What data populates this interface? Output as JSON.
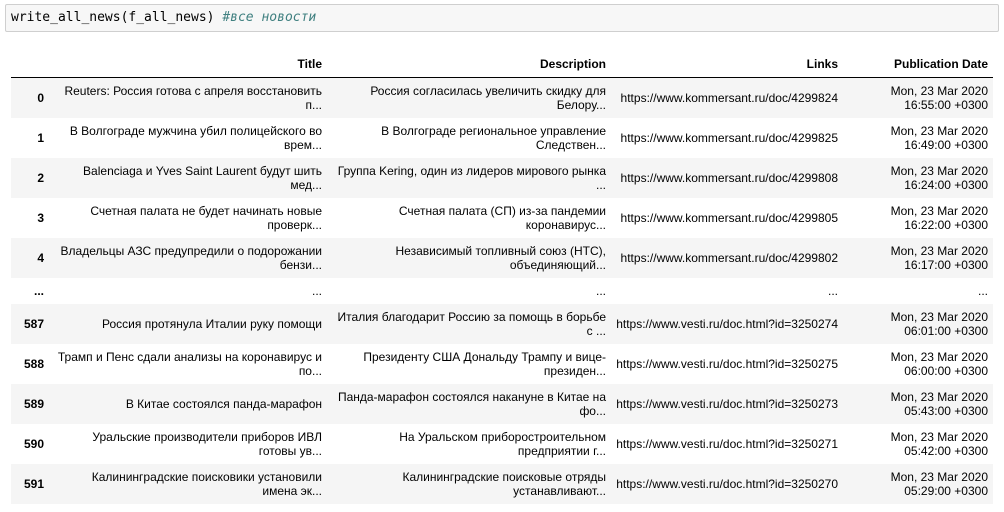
{
  "input": {
    "code": "write_all_news(f_all_news) ",
    "comment": "#все новости"
  },
  "table": {
    "columns": [
      "Title",
      "Description",
      "Links",
      "Publication Date"
    ],
    "rows": [
      {
        "index": "0",
        "title": "Reuters: Россия готова с апреля восстановить п...",
        "description": "Россия согласилась увеличить скидку для Белору...",
        "link": "https://www.kommersant.ru/doc/4299824",
        "date": "Mon, 23 Mar 2020 16:55:00 +0300"
      },
      {
        "index": "1",
        "title": "В Волгограде мужчина убил полицейского во врем...",
        "description": "В Волгограде региональное управление Следствен...",
        "link": "https://www.kommersant.ru/doc/4299825",
        "date": "Mon, 23 Mar 2020 16:49:00 +0300"
      },
      {
        "index": "2",
        "title": "Balenciaga и Yves Saint Laurent будут шить мед...",
        "description": "Группа Kering, один из лидеров мирового рынка ...",
        "link": "https://www.kommersant.ru/doc/4299808",
        "date": "Mon, 23 Mar 2020 16:24:00 +0300"
      },
      {
        "index": "3",
        "title": "Счетная палата не будет начинать новые проверк...",
        "description": "Счетная палата (СП) из-за пандемии коронавирус...",
        "link": "https://www.kommersant.ru/doc/4299805",
        "date": "Mon, 23 Mar 2020 16:22:00 +0300"
      },
      {
        "index": "4",
        "title": "Владельцы АЗС предупредили о подорожании бензи...",
        "description": "Независимый топливный союз (НТС), объединяющий...",
        "link": "https://www.kommersant.ru/doc/4299802",
        "date": "Mon, 23 Mar 2020 16:17:00 +0300"
      },
      {
        "index": "...",
        "title": "...",
        "description": "...",
        "link": "...",
        "date": "..."
      },
      {
        "index": "587",
        "title": "Россия протянула Италии руку помощи",
        "description": "Италия благодарит Россию за помощь в борьбе с ...",
        "link": "https://www.vesti.ru/doc.html?id=3250274",
        "date": "Mon, 23 Mar 2020 06:01:00 +0300"
      },
      {
        "index": "588",
        "title": "Трамп и Пенс сдали анализы на коронавирус и по...",
        "description": "Президенту США Дональду Трампу и вице-президен...",
        "link": "https://www.vesti.ru/doc.html?id=3250275",
        "date": "Mon, 23 Mar 2020 06:00:00 +0300"
      },
      {
        "index": "589",
        "title": "В Китае состоялся панда-марафон",
        "description": "Панда-марафон состоялся накануне в Китае на фо...",
        "link": "https://www.vesti.ru/doc.html?id=3250273",
        "date": "Mon, 23 Mar 2020 05:43:00 +0300"
      },
      {
        "index": "590",
        "title": "Уральские производители приборов ИВЛ готовы ув...",
        "description": "На Уральском приборостроительном предприятии г...",
        "link": "https://www.vesti.ru/doc.html?id=3250271",
        "date": "Mon, 23 Mar 2020 05:42:00 +0300"
      },
      {
        "index": "591",
        "title": "Калининградские поисковики установили имена эк...",
        "description": "Калининградские поисковые отряды устанавливают...",
        "link": "https://www.vesti.ru/doc.html?id=3250270",
        "date": "Mon, 23 Mar 2020 05:29:00 +0300"
      }
    ]
  }
}
